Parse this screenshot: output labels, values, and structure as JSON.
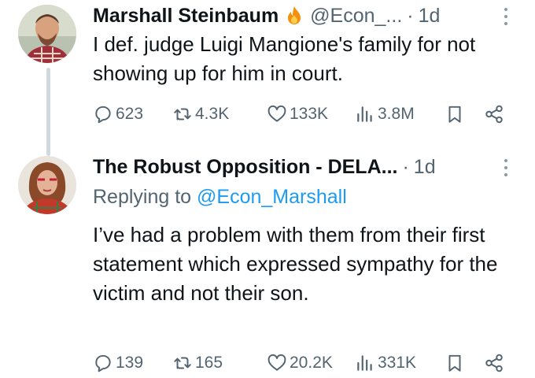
{
  "tweets": [
    {
      "author": "Marshall Steinbaum",
      "emoji": "fire-icon",
      "handle": "@Econ_...",
      "separator": "·",
      "time": "1d",
      "text": "I def. judge Luigi Mangione's family for not showing up for him in court.",
      "stats": {
        "replies": "623",
        "retweets": "4.3K",
        "likes": "133K",
        "views": "3.8M"
      }
    },
    {
      "author": "The Robust Opposition - DELA...",
      "separator": "·",
      "time": "1d",
      "replying_prefix": "Replying to",
      "replying_handle": "@Econ_Marshall",
      "text": "I’ve had a problem with them from their first statement which expressed sympathy for the victim and not their son.",
      "stats": {
        "replies": "139",
        "retweets": "165",
        "likes": "20.2K",
        "views": "331K"
      }
    }
  ],
  "colors": {
    "text": "#0f1419",
    "secondary": "#536471",
    "link": "#1d9bf0",
    "thread_line": "#cfd9de"
  }
}
